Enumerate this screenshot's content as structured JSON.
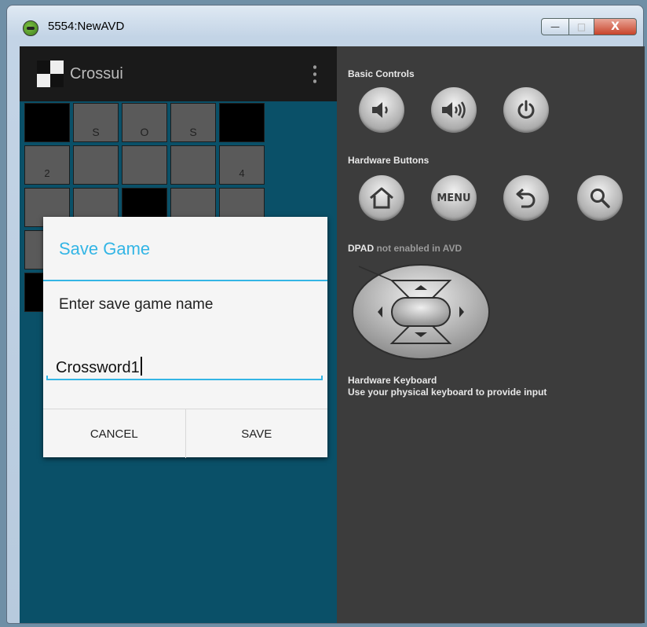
{
  "window": {
    "title": "5554:NewAVD",
    "controls": {
      "minimize": "—",
      "maximize": "□",
      "close": "X"
    }
  },
  "app": {
    "actionbar_title": "Crossui"
  },
  "grid": {
    "rows": [
      [
        {
          "t": "b",
          "v": ""
        },
        {
          "t": "w",
          "v": "S"
        },
        {
          "t": "w",
          "v": "O"
        },
        {
          "t": "w",
          "v": "S"
        },
        {
          "t": "b",
          "v": ""
        }
      ],
      [
        {
          "t": "w",
          "v": "2"
        },
        {
          "t": "w",
          "v": ""
        },
        {
          "t": "w",
          "v": ""
        },
        {
          "t": "w",
          "v": ""
        },
        {
          "t": "w",
          "v": "4"
        }
      ],
      [
        {
          "t": "w",
          "v": ""
        },
        {
          "t": "w",
          "v": ""
        },
        {
          "t": "b",
          "v": ""
        },
        {
          "t": "w",
          "v": ""
        },
        {
          "t": "w",
          "v": ""
        }
      ],
      [
        {
          "t": "w",
          "v": ""
        },
        {
          "t": "w",
          "v": ""
        },
        {
          "t": "w",
          "v": ""
        },
        {
          "t": "w",
          "v": ""
        },
        {
          "t": "w",
          "v": ""
        }
      ],
      [
        {
          "t": "b",
          "v": ""
        },
        {
          "t": "w",
          "v": ""
        },
        {
          "t": "w",
          "v": ""
        },
        {
          "t": "w",
          "v": ""
        },
        {
          "t": "w",
          "v": ""
        }
      ]
    ]
  },
  "dialog": {
    "title": "Save Game",
    "message": "Enter save game name",
    "input_value": "Crossword1",
    "cancel_label": "CANCEL",
    "save_label": "SAVE"
  },
  "panel": {
    "basic_controls_label": "Basic Controls",
    "hardware_buttons_label": "Hardware Buttons",
    "menu_label": "MENU",
    "dpad_label_bold": "DPAD",
    "dpad_label_rest": " not enabled in AVD",
    "keyboard_title": "Hardware Keyboard",
    "keyboard_desc": "Use your physical keyboard to provide input"
  },
  "colors": {
    "accent": "#33b5e5",
    "screen_bg": "#0a5068",
    "panel_bg": "#3c3c3c"
  }
}
